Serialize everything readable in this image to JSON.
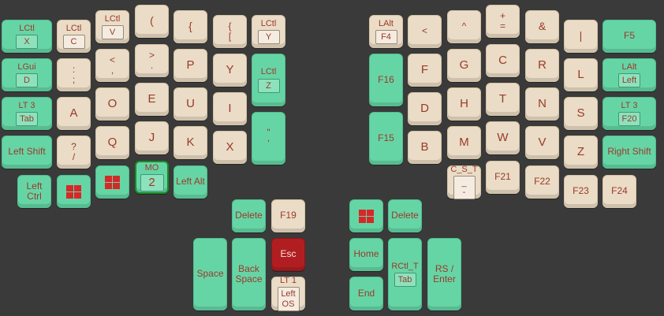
{
  "keys": [
    {
      "id": "lctl-x",
      "pos": [
        2,
        25,
        64,
        42
      ],
      "color": "green",
      "hold": "LCtl",
      "tap": "X",
      "style": "box"
    },
    {
      "id": "lctl-c",
      "pos": [
        72,
        25,
        43,
        42
      ],
      "color": "beige",
      "hold": "LCtl",
      "tap": "C",
      "style": "box"
    },
    {
      "id": "lctl-v",
      "pos": [
        121,
        13,
        43,
        42
      ],
      "color": "beige",
      "hold": "LCtl",
      "tap": "V",
      "style": "box"
    },
    {
      "id": "paren-open",
      "pos": [
        171,
        6,
        43,
        42
      ],
      "color": "beige",
      "tap": "(",
      "style": "sym"
    },
    {
      "id": "brace-open",
      "pos": [
        220,
        13,
        43,
        42
      ],
      "color": "beige",
      "tap": "{",
      "style": "sym"
    },
    {
      "id": "bracket-open",
      "pos": [
        270,
        19,
        43,
        42
      ],
      "color": "beige",
      "tap": "{\n[",
      "style": "plain"
    },
    {
      "id": "lctl-y",
      "pos": [
        319,
        19,
        43,
        42
      ],
      "color": "beige",
      "hold": "LCtl",
      "tap": "Y",
      "style": "box"
    },
    {
      "id": "lgui-d",
      "pos": [
        2,
        74,
        64,
        42
      ],
      "color": "green",
      "hold": "LGui",
      "tap": "D",
      "style": "box"
    },
    {
      "id": "semicolon",
      "pos": [
        72,
        74,
        43,
        42
      ],
      "color": "beige",
      "tap": ":\n;",
      "style": "plain"
    },
    {
      "id": "comma",
      "pos": [
        121,
        62,
        43,
        42
      ],
      "color": "beige",
      "tap": "<\n,",
      "style": "plain"
    },
    {
      "id": "period",
      "pos": [
        171,
        56,
        43,
        42
      ],
      "color": "beige",
      "tap": ">\n.",
      "style": "plain"
    },
    {
      "id": "p",
      "pos": [
        220,
        62,
        43,
        42
      ],
      "color": "beige",
      "tap": "P",
      "style": "big"
    },
    {
      "id": "y",
      "pos": [
        270,
        68,
        43,
        42
      ],
      "color": "beige",
      "tap": "Y",
      "style": "big"
    },
    {
      "id": "lctl-z",
      "pos": [
        319,
        68,
        43,
        67
      ],
      "color": "green",
      "hold": "LCtl",
      "tap": "Z",
      "style": "box"
    },
    {
      "id": "lt3-tab",
      "pos": [
        2,
        123,
        64,
        42
      ],
      "color": "green",
      "hold": "LT 3",
      "tap": "Tab",
      "style": "box"
    },
    {
      "id": "a",
      "pos": [
        72,
        123,
        43,
        42
      ],
      "color": "beige",
      "tap": "A",
      "style": "big"
    },
    {
      "id": "o",
      "pos": [
        121,
        111,
        43,
        42
      ],
      "color": "beige",
      "tap": "O",
      "style": "big"
    },
    {
      "id": "e",
      "pos": [
        171,
        105,
        43,
        42
      ],
      "color": "beige",
      "tap": "E",
      "style": "big"
    },
    {
      "id": "u",
      "pos": [
        220,
        111,
        43,
        42
      ],
      "color": "beige",
      "tap": "U",
      "style": "big"
    },
    {
      "id": "i",
      "pos": [
        270,
        117,
        43,
        42
      ],
      "color": "beige",
      "tap": "I",
      "style": "big"
    },
    {
      "id": "quote",
      "pos": [
        319,
        142,
        43,
        67
      ],
      "color": "green",
      "tap": "\"\n'",
      "style": "plain"
    },
    {
      "id": "left-shift",
      "pos": [
        2,
        172,
        64,
        42
      ],
      "color": "green",
      "tap": "Left Shift",
      "style": "plain"
    },
    {
      "id": "slash",
      "pos": [
        72,
        172,
        43,
        42
      ],
      "color": "beige",
      "tap": "?\n/",
      "style": "plain"
    },
    {
      "id": "q",
      "pos": [
        121,
        160,
        43,
        42
      ],
      "color": "beige",
      "tap": "Q",
      "style": "big"
    },
    {
      "id": "j",
      "pos": [
        171,
        154,
        43,
        42
      ],
      "color": "beige",
      "tap": "J",
      "style": "big"
    },
    {
      "id": "k",
      "pos": [
        220,
        160,
        43,
        42
      ],
      "color": "beige",
      "tap": "K",
      "style": "big"
    },
    {
      "id": "x",
      "pos": [
        270,
        166,
        43,
        42
      ],
      "color": "beige",
      "tap": "X",
      "style": "big"
    },
    {
      "id": "left-ctrl",
      "pos": [
        22,
        222,
        43,
        42
      ],
      "color": "green",
      "tap": "Left\nCtrl",
      "style": "plain"
    },
    {
      "id": "left-gui",
      "pos": [
        72,
        222,
        43,
        42
      ],
      "color": "green",
      "tap": "",
      "style": "win"
    },
    {
      "id": "left-gui-2",
      "pos": [
        121,
        210,
        43,
        42
      ],
      "color": "green",
      "tap": "",
      "style": "win"
    },
    {
      "id": "mo2",
      "pos": [
        171,
        204,
        43,
        42
      ],
      "color": "green",
      "hold": "MO",
      "tap": "2",
      "style": "boxbig",
      "active": true
    },
    {
      "id": "left-alt",
      "pos": [
        220,
        210,
        43,
        42
      ],
      "color": "green",
      "tap": "Left Alt",
      "style": "plain"
    },
    {
      "id": "lalt-f4",
      "pos": [
        468,
        19,
        43,
        42
      ],
      "color": "beige",
      "hold": "LAlt",
      "tap": "F4",
      "style": "box"
    },
    {
      "id": "lt",
      "pos": [
        517,
        19,
        43,
        42
      ],
      "color": "beige",
      "tap": "<",
      "style": "plain"
    },
    {
      "id": "caret",
      "pos": [
        567,
        13,
        43,
        42
      ],
      "color": "beige",
      "tap": "^",
      "style": "plain"
    },
    {
      "id": "plus-eq",
      "pos": [
        616,
        6,
        43,
        42
      ],
      "color": "beige",
      "tap": "+\n=",
      "style": "plain"
    },
    {
      "id": "amp",
      "pos": [
        666,
        13,
        43,
        42
      ],
      "color": "beige",
      "tap": "&",
      "style": "sym"
    },
    {
      "id": "pipe",
      "pos": [
        715,
        25,
        43,
        42
      ],
      "color": "beige",
      "tap": "|",
      "style": "sym"
    },
    {
      "id": "f5",
      "pos": [
        764,
        25,
        68,
        42
      ],
      "color": "green",
      "tap": "F5",
      "style": "plain"
    },
    {
      "id": "f16",
      "pos": [
        468,
        68,
        43,
        67
      ],
      "color": "green",
      "tap": "F16",
      "style": "plain"
    },
    {
      "id": "f",
      "pos": [
        517,
        68,
        43,
        42
      ],
      "color": "beige",
      "tap": "F",
      "style": "big"
    },
    {
      "id": "g",
      "pos": [
        567,
        62,
        43,
        42
      ],
      "color": "beige",
      "tap": "G",
      "style": "big"
    },
    {
      "id": "c",
      "pos": [
        616,
        56,
        43,
        42
      ],
      "color": "beige",
      "tap": "C",
      "style": "big"
    },
    {
      "id": "r",
      "pos": [
        666,
        62,
        43,
        42
      ],
      "color": "beige",
      "tap": "R",
      "style": "big"
    },
    {
      "id": "l",
      "pos": [
        715,
        74,
        43,
        42
      ],
      "color": "beige",
      "tap": "L",
      "style": "big"
    },
    {
      "id": "lalt-left",
      "pos": [
        764,
        74,
        68,
        42
      ],
      "color": "green",
      "hold": "LAlt",
      "tap": "Left",
      "style": "box"
    },
    {
      "id": "f15",
      "pos": [
        468,
        142,
        43,
        67
      ],
      "color": "green",
      "tap": "F15",
      "style": "plain"
    },
    {
      "id": "d",
      "pos": [
        517,
        117,
        43,
        42
      ],
      "color": "beige",
      "tap": "D",
      "style": "big"
    },
    {
      "id": "h",
      "pos": [
        567,
        111,
        43,
        42
      ],
      "color": "beige",
      "tap": "H",
      "style": "big"
    },
    {
      "id": "t",
      "pos": [
        616,
        105,
        43,
        42
      ],
      "color": "beige",
      "tap": "T",
      "style": "big"
    },
    {
      "id": "n",
      "pos": [
        666,
        111,
        43,
        42
      ],
      "color": "beige",
      "tap": "N",
      "style": "big"
    },
    {
      "id": "s",
      "pos": [
        715,
        123,
        43,
        42
      ],
      "color": "beige",
      "tap": "S",
      "style": "big"
    },
    {
      "id": "lt3-f20",
      "pos": [
        764,
        123,
        68,
        42
      ],
      "color": "green",
      "hold": "LT 3",
      "tap": "F20",
      "style": "box"
    },
    {
      "id": "b",
      "pos": [
        517,
        166,
        43,
        42
      ],
      "color": "beige",
      "tap": "B",
      "style": "big"
    },
    {
      "id": "m",
      "pos": [
        567,
        160,
        43,
        42
      ],
      "color": "beige",
      "tap": "M",
      "style": "big"
    },
    {
      "id": "w",
      "pos": [
        616,
        154,
        43,
        42
      ],
      "color": "beige",
      "tap": "W",
      "style": "big"
    },
    {
      "id": "v",
      "pos": [
        666,
        160,
        43,
        42
      ],
      "color": "beige",
      "tap": "V",
      "style": "big"
    },
    {
      "id": "z",
      "pos": [
        715,
        172,
        43,
        42
      ],
      "color": "beige",
      "tap": "Z",
      "style": "big"
    },
    {
      "id": "right-shift",
      "pos": [
        764,
        172,
        68,
        42
      ],
      "color": "green",
      "tap": "Right Shift",
      "style": "plain"
    },
    {
      "id": "cst-minus",
      "pos": [
        567,
        210,
        43,
        42
      ],
      "color": "beige",
      "hold": "C_S_T",
      "tap": "_\n-",
      "style": "box"
    },
    {
      "id": "f21",
      "pos": [
        616,
        204,
        43,
        42
      ],
      "color": "beige",
      "tap": "F21",
      "style": "plain"
    },
    {
      "id": "f22",
      "pos": [
        666,
        210,
        43,
        42
      ],
      "color": "beige",
      "tap": "F22",
      "style": "plain"
    },
    {
      "id": "f23",
      "pos": [
        715,
        222,
        43,
        42
      ],
      "color": "beige",
      "tap": "F23",
      "style": "plain"
    },
    {
      "id": "f24",
      "pos": [
        764,
        222,
        43,
        42
      ],
      "color": "beige",
      "tap": "F24",
      "style": "plain"
    },
    {
      "id": "delete-left",
      "pos": [
        294,
        253,
        43,
        42
      ],
      "color": "green",
      "tap": "Delete",
      "style": "plain"
    },
    {
      "id": "f19",
      "pos": [
        344,
        253,
        43,
        42
      ],
      "color": "beige",
      "tap": "F19",
      "style": "plain"
    },
    {
      "id": "space",
      "pos": [
        245,
        302,
        43,
        92
      ],
      "color": "green",
      "tap": "Space",
      "style": "plain"
    },
    {
      "id": "backspace",
      "pos": [
        294,
        302,
        43,
        92
      ],
      "color": "green",
      "tap": "Back\nSpace",
      "style": "plain"
    },
    {
      "id": "esc",
      "pos": [
        344,
        302,
        43,
        42
      ],
      "color": "red",
      "tap": "Esc",
      "style": "plain"
    },
    {
      "id": "lt1-leftos",
      "pos": [
        344,
        351,
        43,
        43
      ],
      "color": "beige",
      "hold": "LT 1",
      "tap": "Left\nOS",
      "style": "box"
    },
    {
      "id": "right-gui",
      "pos": [
        443,
        253,
        43,
        42
      ],
      "color": "green",
      "tap": "",
      "style": "win"
    },
    {
      "id": "delete-right",
      "pos": [
        492,
        253,
        43,
        42
      ],
      "color": "green",
      "tap": "Delete",
      "style": "plain"
    },
    {
      "id": "home",
      "pos": [
        443,
        302,
        43,
        42
      ],
      "color": "green",
      "tap": "Home",
      "style": "plain"
    },
    {
      "id": "rctl-tab",
      "pos": [
        492,
        302,
        43,
        92
      ],
      "color": "green",
      "hold": "RCtl_T",
      "tap": "Tab",
      "style": "box"
    },
    {
      "id": "rs-enter",
      "pos": [
        542,
        302,
        43,
        92
      ],
      "color": "green",
      "tap": "RS /\nEnter",
      "style": "plain"
    },
    {
      "id": "end",
      "pos": [
        443,
        351,
        43,
        43
      ],
      "color": "green",
      "tap": "End",
      "style": "plain"
    }
  ]
}
